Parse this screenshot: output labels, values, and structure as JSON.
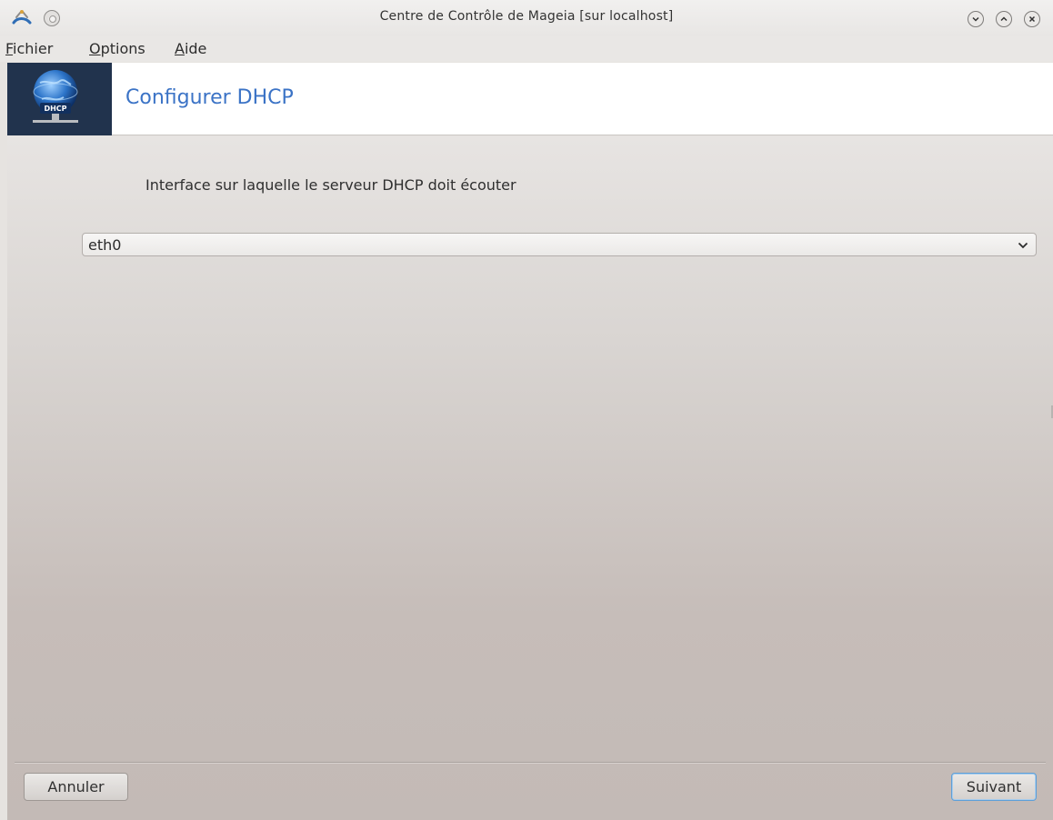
{
  "window": {
    "title": "Centre de Contrôle de Mageia  [sur localhost]"
  },
  "menubar": {
    "items": [
      {
        "accel": "F",
        "rest": "ichier"
      },
      {
        "accel": "O",
        "rest": "ptions"
      },
      {
        "accel": "A",
        "rest": "ide"
      }
    ]
  },
  "banner": {
    "title": "Configurer DHCP",
    "icon": "dhcp-globe-icon",
    "icon_caption": "DHCP",
    "bg_color": "#21334d",
    "title_color": "#3b73c6"
  },
  "main": {
    "prompt": "Interface sur laquelle le serveur DHCP doit écouter",
    "interface_select": {
      "selected": "eth0"
    }
  },
  "footer": {
    "cancel_label": "Annuler",
    "next_label": "Suivant"
  }
}
